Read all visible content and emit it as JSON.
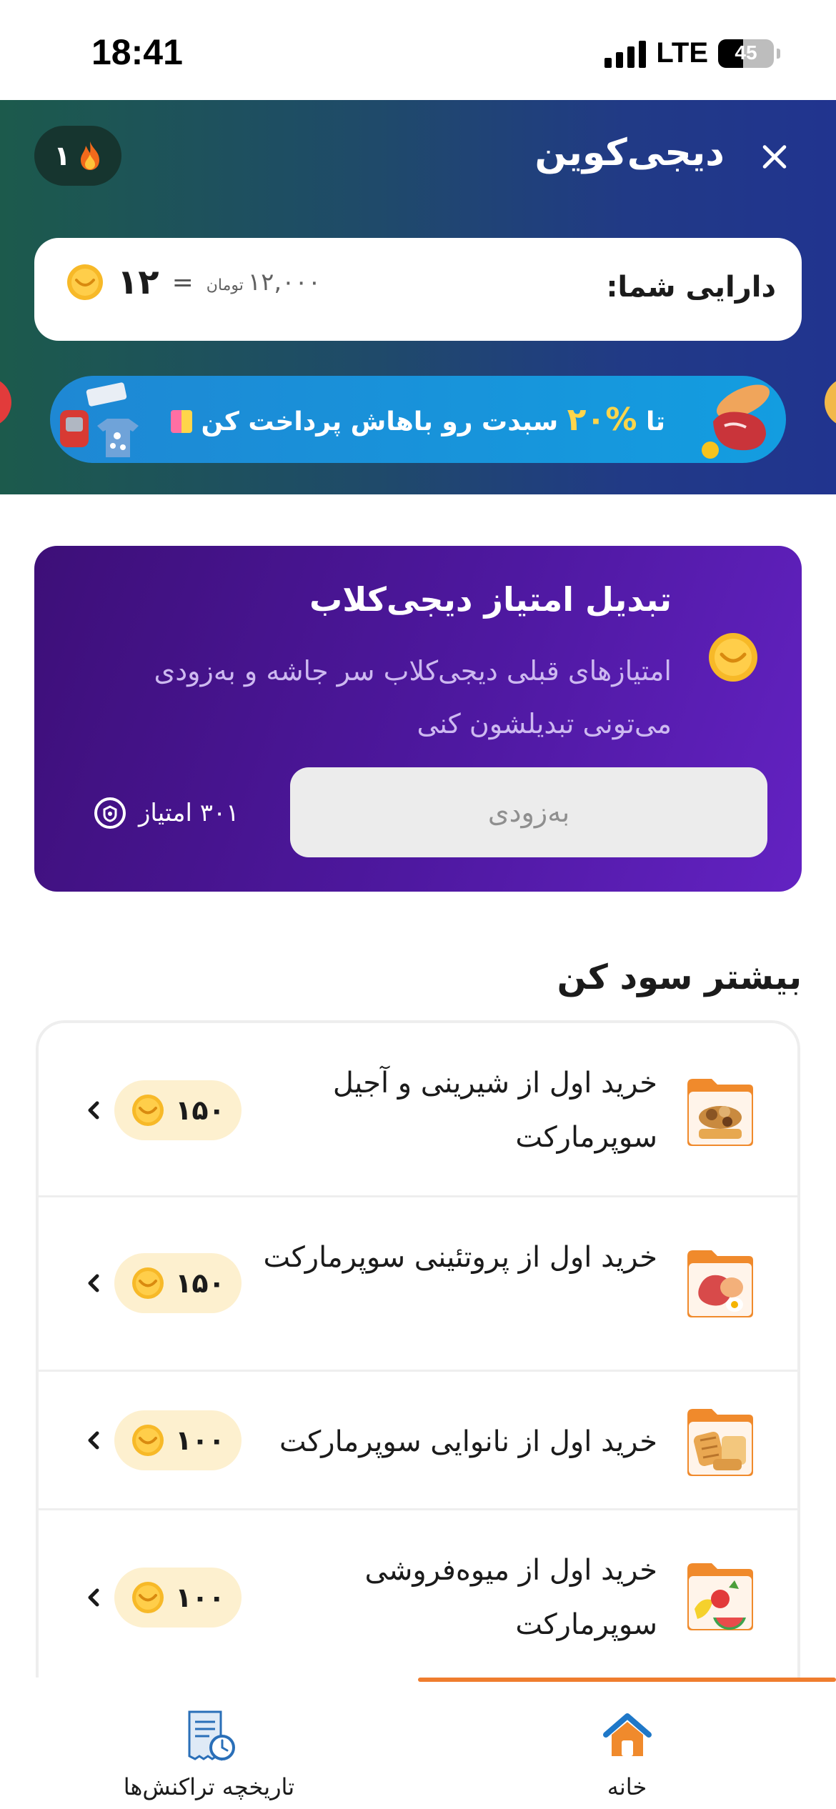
{
  "status_bar": {
    "time": "18:41",
    "network": "LTE",
    "battery": "45",
    "battery_level": 0.45
  },
  "header": {
    "title": "دیجی‌کوین",
    "streak_count": "۱",
    "close_icon": "close-icon",
    "streak_icon": "flame-icon"
  },
  "balance": {
    "label": "دارایی شما:",
    "coins": "۱۲",
    "equals": "=",
    "toman_value": "۱۲,۰۰۰",
    "toman_unit": "تومان"
  },
  "promo_banner": {
    "text_prefix": "تا",
    "percent": "%۲۰",
    "text_suffix": "سبدت رو باهاش پرداخت کن"
  },
  "convert": {
    "title": "تبدیل امتیاز دیجی‌کلاب",
    "description": "امتیازهای قبلی دیجی‌کلاب سر جاشه و به‌زودی می‌تونی تبدیلشون کنی",
    "button_label": "به‌زودی",
    "points": "۳۰۱ امتیاز"
  },
  "earn_section": {
    "title": "بیشتر سود کن",
    "tasks": [
      {
        "title": "خرید اول از شیرینی و آجیل سوپرمارکت",
        "reward": "۱۵۰",
        "icon": "sweets-nuts-folder-icon"
      },
      {
        "title": "خرید اول از پروتئینی سوپرمارکت",
        "reward": "۱۵۰",
        "icon": "protein-folder-icon"
      },
      {
        "title": "خرید اول از نانوایی سوپرمارکت",
        "reward": "۱۰۰",
        "icon": "bakery-folder-icon"
      },
      {
        "title": "خرید اول از میوه‌فروشی سوپرمارکت",
        "reward": "۱۰۰",
        "icon": "fruit-folder-icon"
      }
    ]
  },
  "bottom_nav": {
    "items": [
      {
        "label": "خانه",
        "icon": "home-icon",
        "active": true
      },
      {
        "label": "تاریخچه تراکنش‌ها",
        "icon": "transaction-history-icon",
        "active": false
      }
    ]
  },
  "colors": {
    "accent_orange": "#ef7d2e",
    "header_green": "#1c5a4c",
    "header_blue": "#21348f",
    "purple": "#4e18a0",
    "coin_gold": "#f7b928",
    "reward_bg": "#fdf0cf"
  }
}
